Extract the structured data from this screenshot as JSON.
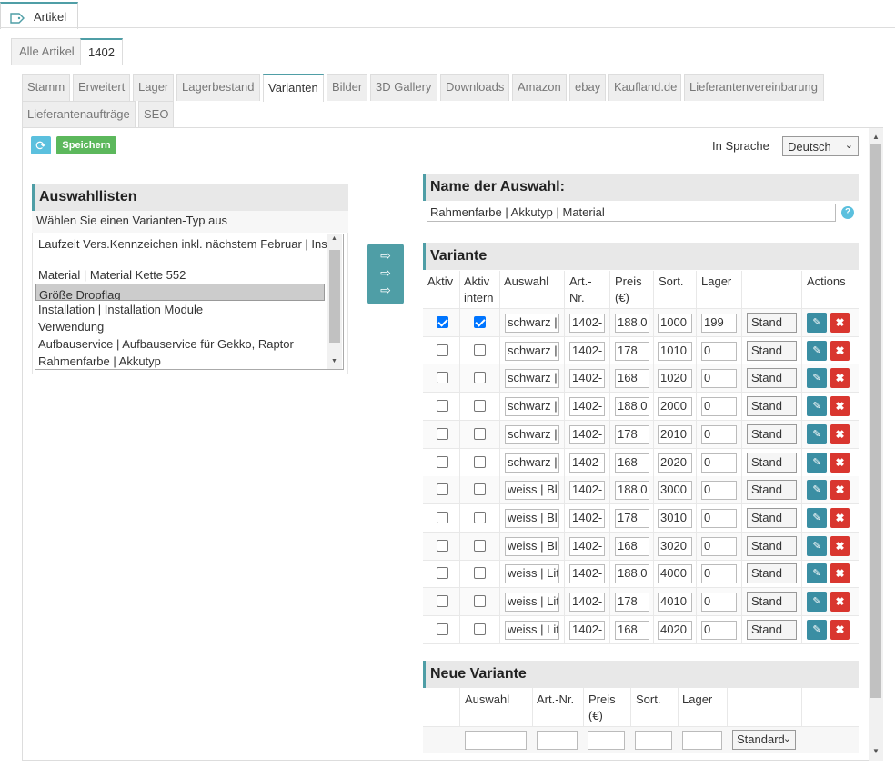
{
  "top_tab": {
    "icon": "tag-icon",
    "label": "Artikel"
  },
  "article_tabs": {
    "all": "Alle Artikel",
    "current": "1402"
  },
  "section_tabs": [
    {
      "label": "Stamm"
    },
    {
      "label": "Erweitert"
    },
    {
      "label": "Lager"
    },
    {
      "label": "Lagerbestand"
    },
    {
      "label": "Varianten",
      "active": true
    },
    {
      "label": "Bilder"
    },
    {
      "label": "3D Gallery"
    },
    {
      "label": "Downloads"
    },
    {
      "label": "Amazon"
    },
    {
      "label": "ebay"
    },
    {
      "label": "Kaufland.de"
    },
    {
      "label": "Lieferantenvereinbarung"
    },
    {
      "label": "Lieferantenaufträge"
    },
    {
      "label": "SEO"
    }
  ],
  "toolbar": {
    "refresh_icon": "refresh-icon",
    "save_label": "Speichern",
    "lang_label": "In Sprache",
    "lang_value": "Deutsch"
  },
  "auswahllisten": {
    "title": "Auswahllisten",
    "subtitle": "Wählen Sie einen Varianten-Typ aus",
    "items": [
      "Laufzeit Vers.Kennzeichen inkl. nächstem Februar | Ins",
      "",
      "Material | Material Kette 552",
      "Größe Dropflag",
      "Installation | Installation Module",
      "Verwendung",
      "Aufbauservice | Aufbauservice für Gekko, Raptor",
      "Rahmenfarbe | Akkutyp"
    ],
    "selected_index": 3
  },
  "move_button_icon": "arrow-right-icon",
  "name_section": {
    "title": "Name der Auswahl:",
    "value": "Rahmenfarbe | Akkutyp | Material",
    "help": "?"
  },
  "variante": {
    "title": "Variante",
    "headers": {
      "aktiv": "Aktiv",
      "aktiv_intern_1": "Aktiv",
      "aktiv_intern_2": "intern",
      "auswahl": "Auswahl",
      "artnr_1": "Art.-",
      "artnr_2": "Nr.",
      "preis_1": "Preis",
      "preis_2": "(€)",
      "sort": "Sort.",
      "lager": "Lager",
      "actions": "Actions"
    },
    "rows": [
      {
        "aktiv": true,
        "intern": true,
        "auswahl": "schwarz | B",
        "artnr": "1402-",
        "preis": "188.0",
        "sort": "1000",
        "lager": "199",
        "typ": "Stand"
      },
      {
        "aktiv": false,
        "intern": false,
        "auswahl": "schwarz | B",
        "artnr": "1402-",
        "preis": "178",
        "sort": "1010",
        "lager": "0",
        "typ": "Stand"
      },
      {
        "aktiv": false,
        "intern": false,
        "auswahl": "schwarz | B",
        "artnr": "1402-",
        "preis": "168",
        "sort": "1020",
        "lager": "0",
        "typ": "Stand"
      },
      {
        "aktiv": false,
        "intern": false,
        "auswahl": "schwarz | L",
        "artnr": "1402-",
        "preis": "188.0",
        "sort": "2000",
        "lager": "0",
        "typ": "Stand"
      },
      {
        "aktiv": false,
        "intern": false,
        "auswahl": "schwarz | L",
        "artnr": "1402-",
        "preis": "178",
        "sort": "2010",
        "lager": "0",
        "typ": "Stand"
      },
      {
        "aktiv": false,
        "intern": false,
        "auswahl": "schwarz | L",
        "artnr": "1402-",
        "preis": "168",
        "sort": "2020",
        "lager": "0",
        "typ": "Stand"
      },
      {
        "aktiv": false,
        "intern": false,
        "auswahl": "weiss | Ble",
        "artnr": "1402-",
        "preis": "188.0",
        "sort": "3000",
        "lager": "0",
        "typ": "Stand"
      },
      {
        "aktiv": false,
        "intern": false,
        "auswahl": "weiss | Ble",
        "artnr": "1402-",
        "preis": "178",
        "sort": "3010",
        "lager": "0",
        "typ": "Stand"
      },
      {
        "aktiv": false,
        "intern": false,
        "auswahl": "weiss | Ble",
        "artnr": "1402-",
        "preis": "168",
        "sort": "3020",
        "lager": "0",
        "typ": "Stand"
      },
      {
        "aktiv": false,
        "intern": false,
        "auswahl": "weiss | Lit",
        "artnr": "1402-",
        "preis": "188.0",
        "sort": "4000",
        "lager": "0",
        "typ": "Stand"
      },
      {
        "aktiv": false,
        "intern": false,
        "auswahl": "weiss | Lit",
        "artnr": "1402-",
        "preis": "178",
        "sort": "4010",
        "lager": "0",
        "typ": "Stand"
      },
      {
        "aktiv": false,
        "intern": false,
        "auswahl": "weiss | Lit",
        "artnr": "1402-",
        "preis": "168",
        "sort": "4020",
        "lager": "0",
        "typ": "Stand"
      }
    ],
    "edit_icon": "edit-icon",
    "delete_icon": "delete-icon"
  },
  "neue_variante": {
    "title": "Neue Variante",
    "headers": {
      "auswahl": "Auswahl",
      "artnr": "Art.-Nr.",
      "preis_1": "Preis",
      "preis_2": "(€)",
      "sort": "Sort.",
      "lager": "Lager"
    },
    "typ": "Standard"
  }
}
